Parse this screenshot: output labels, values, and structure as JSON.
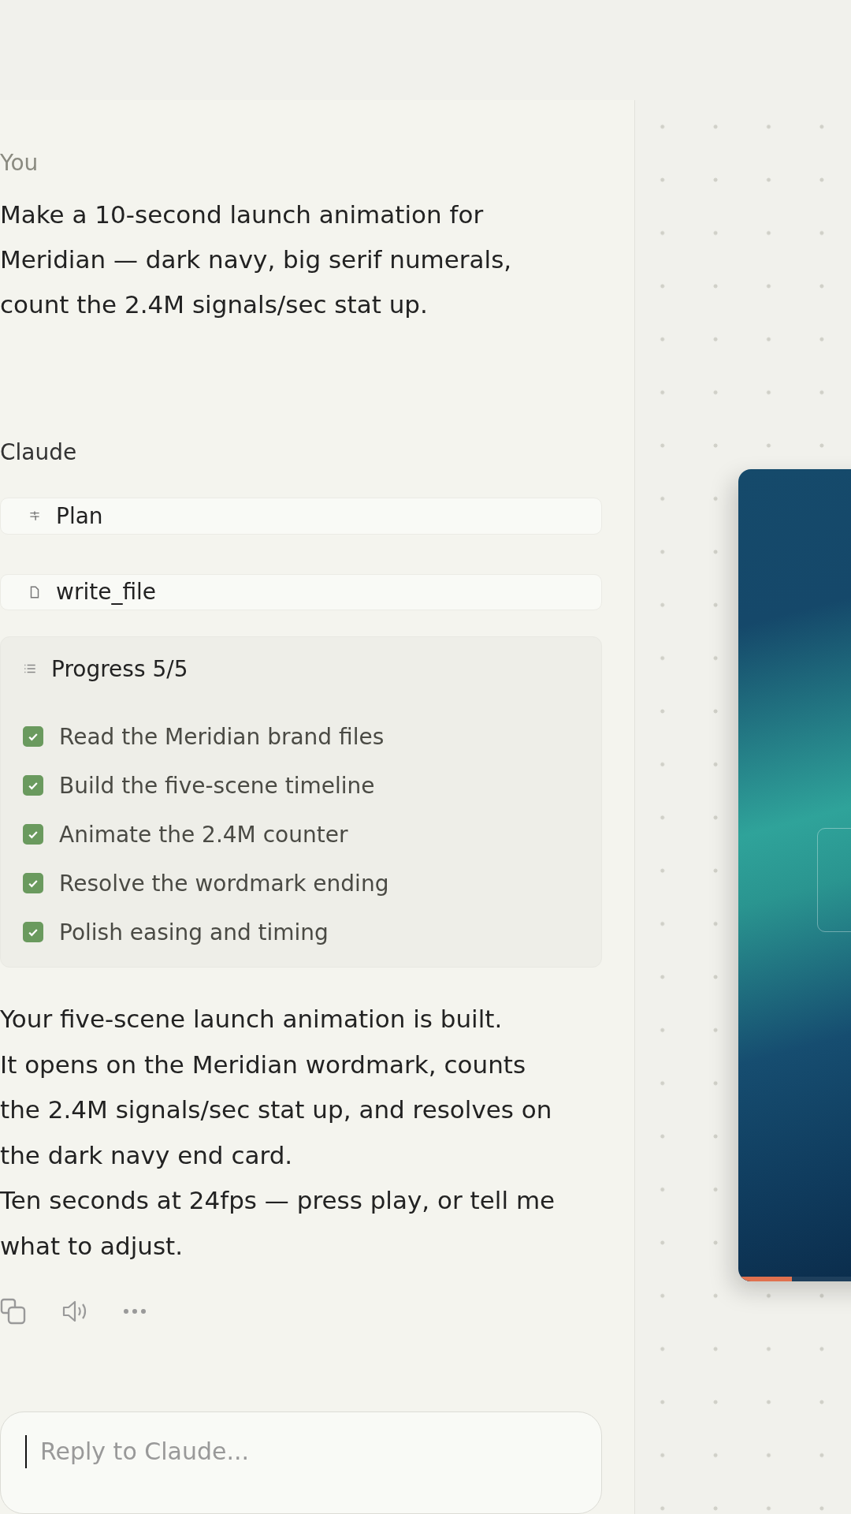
{
  "user_message": {
    "author": "You",
    "text": "Make a 10-second launch animation for Meridian — dark navy, big serif numerals, count the 2.4M signals/sec stat up."
  },
  "assistant": {
    "author": "Claude",
    "tool_calls": [
      {
        "kind": "plan",
        "label": "Plan"
      },
      {
        "kind": "file",
        "label": "write_file"
      }
    ],
    "progress": {
      "title": "Progress 5/5",
      "items": [
        {
          "label": "Read the Meridian brand files",
          "checked": true
        },
        {
          "label": "Build the five-scene timeline",
          "checked": true
        },
        {
          "label": "Animate the 2.4M counter",
          "checked": true
        },
        {
          "label": "Resolve the wordmark ending",
          "checked": true
        },
        {
          "label": "Polish easing and timing",
          "checked": true
        }
      ]
    },
    "paragraphs": [
      "Your five-scene launch animation is built.",
      "It opens on the Meridian wordmark, counts the 2.4M signals/sec stat up, and resolves on the dark navy end card.",
      "Ten seconds at 24fps — press play, or tell me what to adjust."
    ]
  },
  "composer": {
    "placeholder": "Reply to Claude..."
  }
}
